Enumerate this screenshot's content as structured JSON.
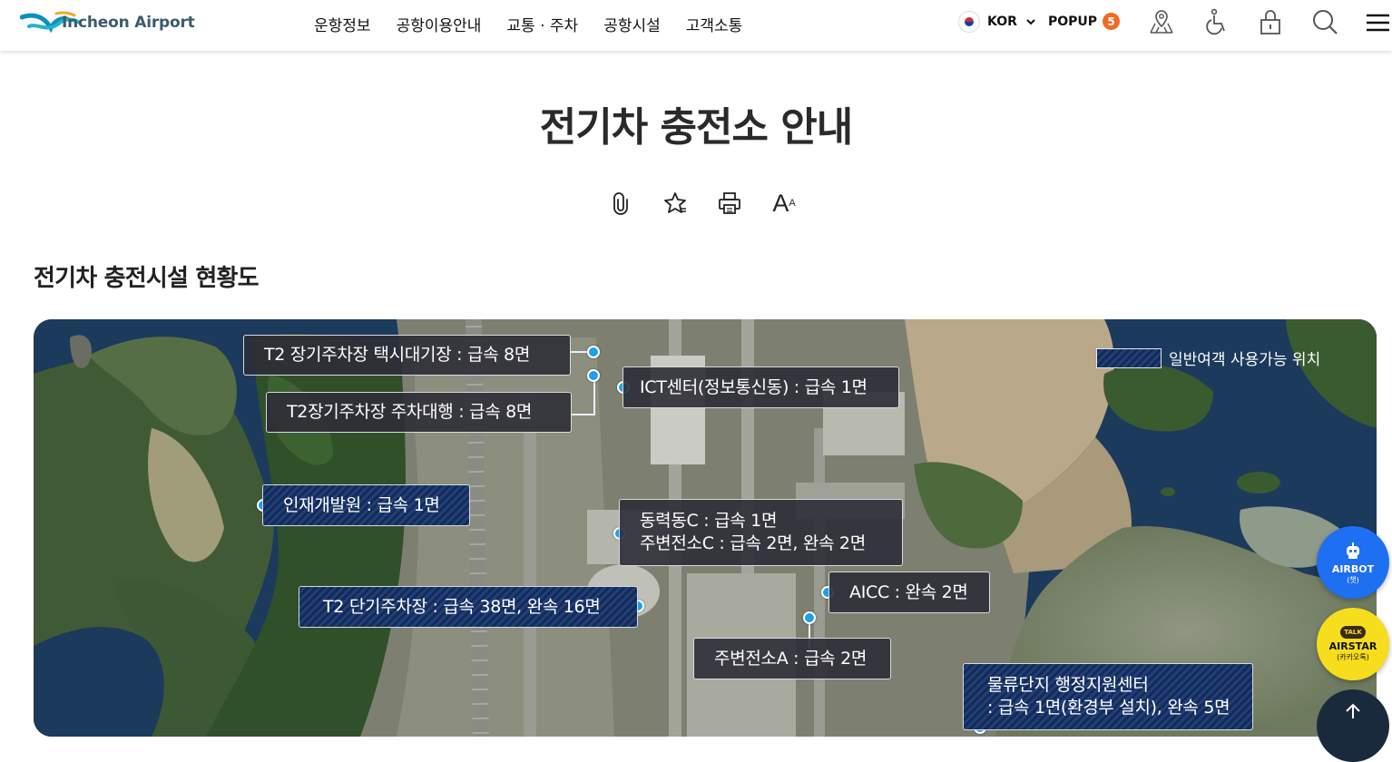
{
  "header": {
    "logo_text": "Incheon Airport",
    "nav": [
      "운항정보",
      "공항이용안내",
      "교통 · 주차",
      "공항시설",
      "고객소통"
    ],
    "lang": "KOR",
    "popup_label": "POPUP",
    "popup_count": "5",
    "icons": [
      "map-pin-icon",
      "wheelchair-icon",
      "lock-icon",
      "search-icon",
      "hamburger-menu-icon"
    ]
  },
  "page": {
    "title": "전기차 충전소 안내",
    "tools": [
      "clip-icon",
      "favorite-star-icon",
      "print-icon",
      "font-size-icon"
    ],
    "font_tool_big": "A",
    "font_tool_small": "A",
    "section_title": "전기차 충전시설 현황도"
  },
  "map": {
    "legend": "일반여객 사용가능 위치",
    "labels": {
      "t2_long_taxi": "T2 장기주차장 택시대기장 : 급속 8면",
      "t2_long_valet": "T2장기주차장 주차대행 : 급속 8면",
      "ict_center": "ICT센터(정보통신동) : 급속 1면",
      "hr_institute": "인재개발원 : 급속 1면",
      "power_c_line1": "동력동C : 급속 1면",
      "power_c_line2": "주변전소C : 급속 2면, 완속 2면",
      "aicc": "AICC : 완속 2면",
      "t2_short": "T2 단기주차장 : 급속 38면, 완속 16면",
      "substation_a": "주변전소A : 급속 2면",
      "logistics_line1": "물류단지 행정지원센터",
      "logistics_line2": ": 급속 1면(환경부 설치), 완속 5면"
    }
  },
  "floating": {
    "airbot": "AIRBOT",
    "airbot_sub": "(챗)",
    "airstar_badge": "TALK",
    "airstar": "AIRSTAR",
    "airstar_sub": "(카카오톡)"
  }
}
